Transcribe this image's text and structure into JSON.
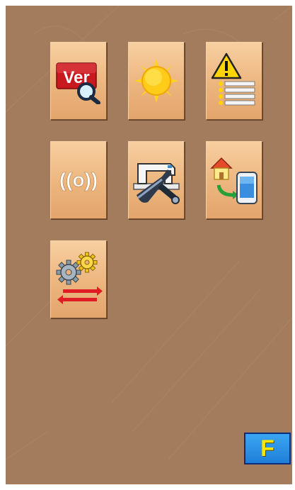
{
  "screen": {
    "background": "#a27c5c"
  },
  "tiles": [
    {
      "id": "version",
      "icon": "version-search-icon",
      "icon_text": "Ver"
    },
    {
      "id": "brightness",
      "icon": "sun-icon"
    },
    {
      "id": "alarm-list",
      "icon": "warning-list-icon"
    },
    {
      "id": "wireless",
      "icon": "wireless-signal-icon",
      "icon_text": "((o))"
    },
    {
      "id": "machine-maintenance",
      "icon": "sewing-machine-wrench-icon"
    },
    {
      "id": "home-to-device",
      "icon": "home-device-transfer-icon"
    },
    {
      "id": "parameter-exchange",
      "icon": "gears-arrows-icon"
    }
  ],
  "function_button": {
    "label": "F",
    "color": "#1f7fd8",
    "text_color": "#ffe600"
  }
}
